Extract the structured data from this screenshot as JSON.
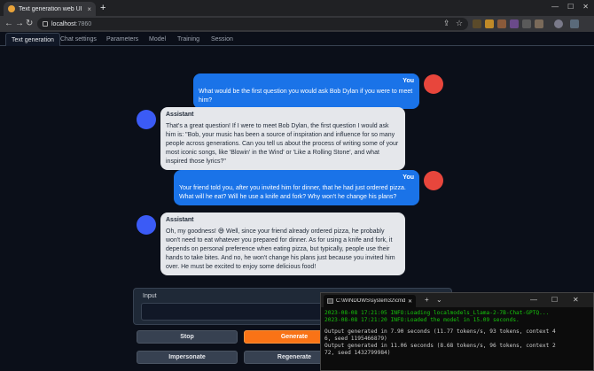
{
  "browser": {
    "tab_title": "Text generation web UI",
    "tab_close": "×",
    "new_tab": "+",
    "url_host": "localhost",
    "url_port": ":7860"
  },
  "app_tabs": [
    "Text generation",
    "Chat settings",
    "Parameters",
    "Model",
    "Training",
    "Session"
  ],
  "chat": [
    {
      "role": "user",
      "name": "You",
      "text": "What would be the first question you would ask Bob Dylan if you were to meet him?"
    },
    {
      "role": "assistant",
      "name": "Assistant",
      "text": "That's a great question! If I were to meet Bob Dylan, the first question I would ask him is: \"Bob, your music has been a source of inspiration and influence for so many people across generations. Can you tell us about the process of writing some of your most iconic songs, like 'Blowin' in the Wind' or 'Like a Rolling Stone', and what inspired those lyrics?\""
    },
    {
      "role": "user",
      "name": "You",
      "text": "Your friend told you, after you invited him for dinner, that he had just ordered pizza. What will he eat? Will he use a knife and fork? Why won't he change his plans?"
    },
    {
      "role": "assistant",
      "name": "Assistant",
      "text": "Oh, my goodness! 😅 Well, since your friend already ordered pizza, he probably won't need to eat whatever you prepared for dinner. As for using a knife and fork, it depends on personal preference when eating pizza, but typically, people use their hands to take bites. And no, he won't change his plans just because you invited him over. He must be excited to enjoy some delicious food!"
    }
  ],
  "input": {
    "label": "Input",
    "value": ""
  },
  "buttons": {
    "stop": "Stop",
    "generate": "Generate",
    "impersonate": "Impersonate",
    "regenerate": "Regenerate"
  },
  "terminal": {
    "title": "C:\\WINDOWS\\system32\\cmd.",
    "lines": [
      {
        "text": "2023-08-08 17:21:05 INFO:Loading localmodels_Llama-2-7B-Chat-GPTQ...",
        "color": "green"
      },
      {
        "text": "2023-08-08 17:21:20 INFO:Loaded the model in 15.09 seconds.",
        "color": "green"
      },
      {
        "text": "",
        "color": "gap"
      },
      {
        "text": "Output generated in 7.90 seconds (11.77 tokens/s, 93 tokens, context 4",
        "color": "white"
      },
      {
        "text": "6, seed 1195466879)",
        "color": "white"
      },
      {
        "text": "Output generated in 11.06 seconds (8.68 tokens/s, 96 tokens, context 2",
        "color": "white"
      },
      {
        "text": "72, seed 1432799984)",
        "color": "white"
      }
    ]
  },
  "colors": {
    "user_bubble": "#1a73e8",
    "user_avatar": "#e8463c",
    "assistant_avatar": "#3b5bf6",
    "generate_button": "#f97316"
  }
}
